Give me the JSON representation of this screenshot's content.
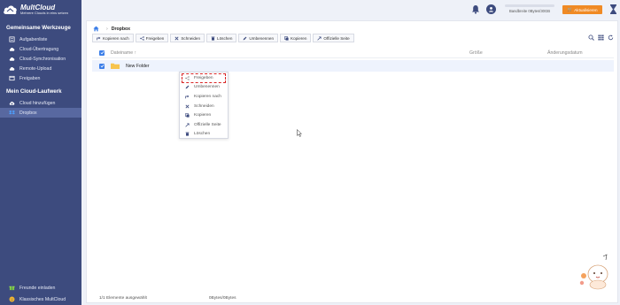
{
  "app": {
    "title": "MultCloud",
    "subtitle": "Mehrere Clouds in eins setzen"
  },
  "sidebar": {
    "section1_title": "Gemeinsame Werkzeuge",
    "section1_items": [
      {
        "label": "Aufgabenliste",
        "icon": "list-icon"
      },
      {
        "label": "Cloud-Übertragung",
        "icon": "cloud-transfer-icon"
      },
      {
        "label": "Cloud-Synchronisation",
        "icon": "cloud-sync-icon"
      },
      {
        "label": "Remote-Upload",
        "icon": "cloud-upload-icon"
      },
      {
        "label": "Freigaben",
        "icon": "share-icon"
      }
    ],
    "section2_title": "Mein Cloud-Laufwerk",
    "section2_items": [
      {
        "label": "Cloud hinzufügen",
        "icon": "add-cloud-icon"
      },
      {
        "label": "Dropbox",
        "icon": "dropbox-icon",
        "active": true
      }
    ],
    "bottom_items": [
      {
        "label": "Freunde einladen",
        "icon": "gift-icon"
      },
      {
        "label": "Klassisches MultCloud",
        "icon": "smiley-icon"
      }
    ]
  },
  "header": {
    "bandwidth_text": "Bandbreite 0Bytes/30GB",
    "upgrade_label": "Aktualisieren"
  },
  "breadcrumb": {
    "current": "Dropbox"
  },
  "toolbar": {
    "buttons": [
      {
        "label": "Kopieren nach",
        "icon": "copy-to-icon"
      },
      {
        "label": "Freigeben",
        "icon": "share-icon"
      },
      {
        "label": "Schneiden",
        "icon": "cut-icon"
      },
      {
        "label": "Löschen",
        "icon": "trash-icon"
      },
      {
        "label": "Umbenennen",
        "icon": "pencil-icon"
      },
      {
        "label": "Kopieren",
        "icon": "copy-icon"
      },
      {
        "label": "Offizielle Seite",
        "icon": "external-link-icon"
      }
    ]
  },
  "table": {
    "columns": {
      "name": "Dateiname ↑",
      "size": "Größe",
      "date": "Änderungsdatum"
    },
    "rows": [
      {
        "name": "New Folder",
        "size": "",
        "date": ""
      }
    ]
  },
  "context_menu": {
    "items": [
      {
        "label": "Freigeben",
        "highlighted": true
      },
      {
        "label": "Umbenennen"
      },
      {
        "label": "Kopieren nach"
      },
      {
        "label": "Schneiden"
      },
      {
        "label": "Kopieren"
      },
      {
        "label": "Offizielle Seite"
      },
      {
        "label": "Löschen"
      }
    ]
  },
  "status": {
    "selected": "1/1 Elemente ausgewählt",
    "size": "0Bytes/0Bytes"
  },
  "colors": {
    "sidebar_bg": "#3d4b7e",
    "accent_blue": "#3b7ee8",
    "upgrade_orange": "#f08a24",
    "highlight_red": "#d92626"
  }
}
